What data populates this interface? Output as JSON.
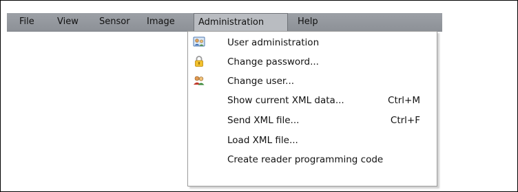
{
  "menubar": {
    "items": [
      {
        "label": "File"
      },
      {
        "label": "View"
      },
      {
        "label": "Sensor"
      },
      {
        "label": "Image"
      },
      {
        "label": "Administration"
      },
      {
        "label": "Help"
      }
    ],
    "active_index": 4
  },
  "dropdown": {
    "items": [
      {
        "label": "User administration",
        "icon": "user-admin-icon"
      },
      {
        "label": "Change password...",
        "icon": "padlock-icon"
      },
      {
        "label": "Change user...",
        "icon": "users-icon"
      },
      {
        "label": "Show current XML data...",
        "shortcut": "Ctrl+M"
      },
      {
        "label": "Send XML file...",
        "shortcut": "Ctrl+F"
      },
      {
        "label": "Load XML file..."
      },
      {
        "label": "Create reader programming code"
      }
    ]
  },
  "colors": {
    "menubar_bg": "#969aa0",
    "active_bg": "#b9bcc1",
    "dropdown_bg": "#ffffff",
    "text": "#111111"
  }
}
